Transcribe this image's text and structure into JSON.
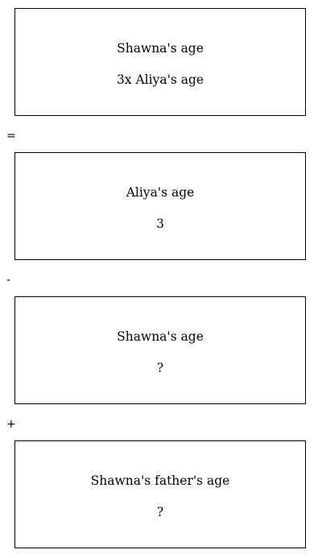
{
  "boxes": [
    {
      "label": "Shawna's age",
      "value": "3x Aliya's age"
    },
    {
      "label": "Aliya's age",
      "value": "3"
    },
    {
      "label": "Shawna's age",
      "value": "?"
    },
    {
      "label": "Shawna's father's age",
      "value": "?"
    }
  ],
  "operators": [
    "=",
    "-",
    "+"
  ]
}
